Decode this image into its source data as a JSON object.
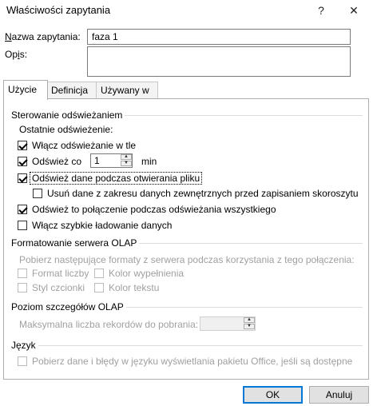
{
  "window": {
    "title": "Właściwości zapytania",
    "help_glyph": "?",
    "close_glyph": "✕"
  },
  "query": {
    "name_label": "Nazwa zapytania:",
    "name_value": "faza 1",
    "desc_label": "Opis:",
    "desc_value": ""
  },
  "tabs": [
    {
      "label": "Użycie"
    },
    {
      "label": "Definicja"
    },
    {
      "label": "Używany w"
    }
  ],
  "refresh": {
    "section": "Sterowanie odświeżaniem",
    "last_refresh": "Ostatnie odświeżenie:",
    "background": "Włącz odświeżanie w tle",
    "every_label": "Odśwież co",
    "every_value": "1",
    "every_unit": "min",
    "on_open": "Odśwież dane podczas otwierania pliku",
    "remove_data": "Usuń dane z zakresu danych zewnętrznych przed zapisaniem skoroszytu",
    "refresh_all": "Odśwież to połączenie podczas odświeżania wszystkiego",
    "fast_load": "Włącz szybkie ładowanie danych"
  },
  "olap_format": {
    "section": "Formatowanie serwera OLAP",
    "desc": "Pobierz następujące formaty z serwera podczas korzystania z tego połączenia:",
    "number_format": "Format liczby",
    "fill_color": "Kolor wypełnienia",
    "font_style": "Styl czcionki",
    "text_color": "Kolor tekstu"
  },
  "olap_detail": {
    "section": "Poziom szczegółów OLAP",
    "max_records": "Maksymalna liczba rekordów do pobrania:",
    "max_value": ""
  },
  "language": {
    "section": "Język",
    "office_lang": "Pobierz dane i błędy w języku wyświetlania pakietu Office, jeśli są dostępne"
  },
  "buttons": {
    "ok": "OK",
    "cancel": "Anuluj"
  },
  "colors": {
    "accent": "#0078d7",
    "disabled_text": "#a0a0a0"
  }
}
